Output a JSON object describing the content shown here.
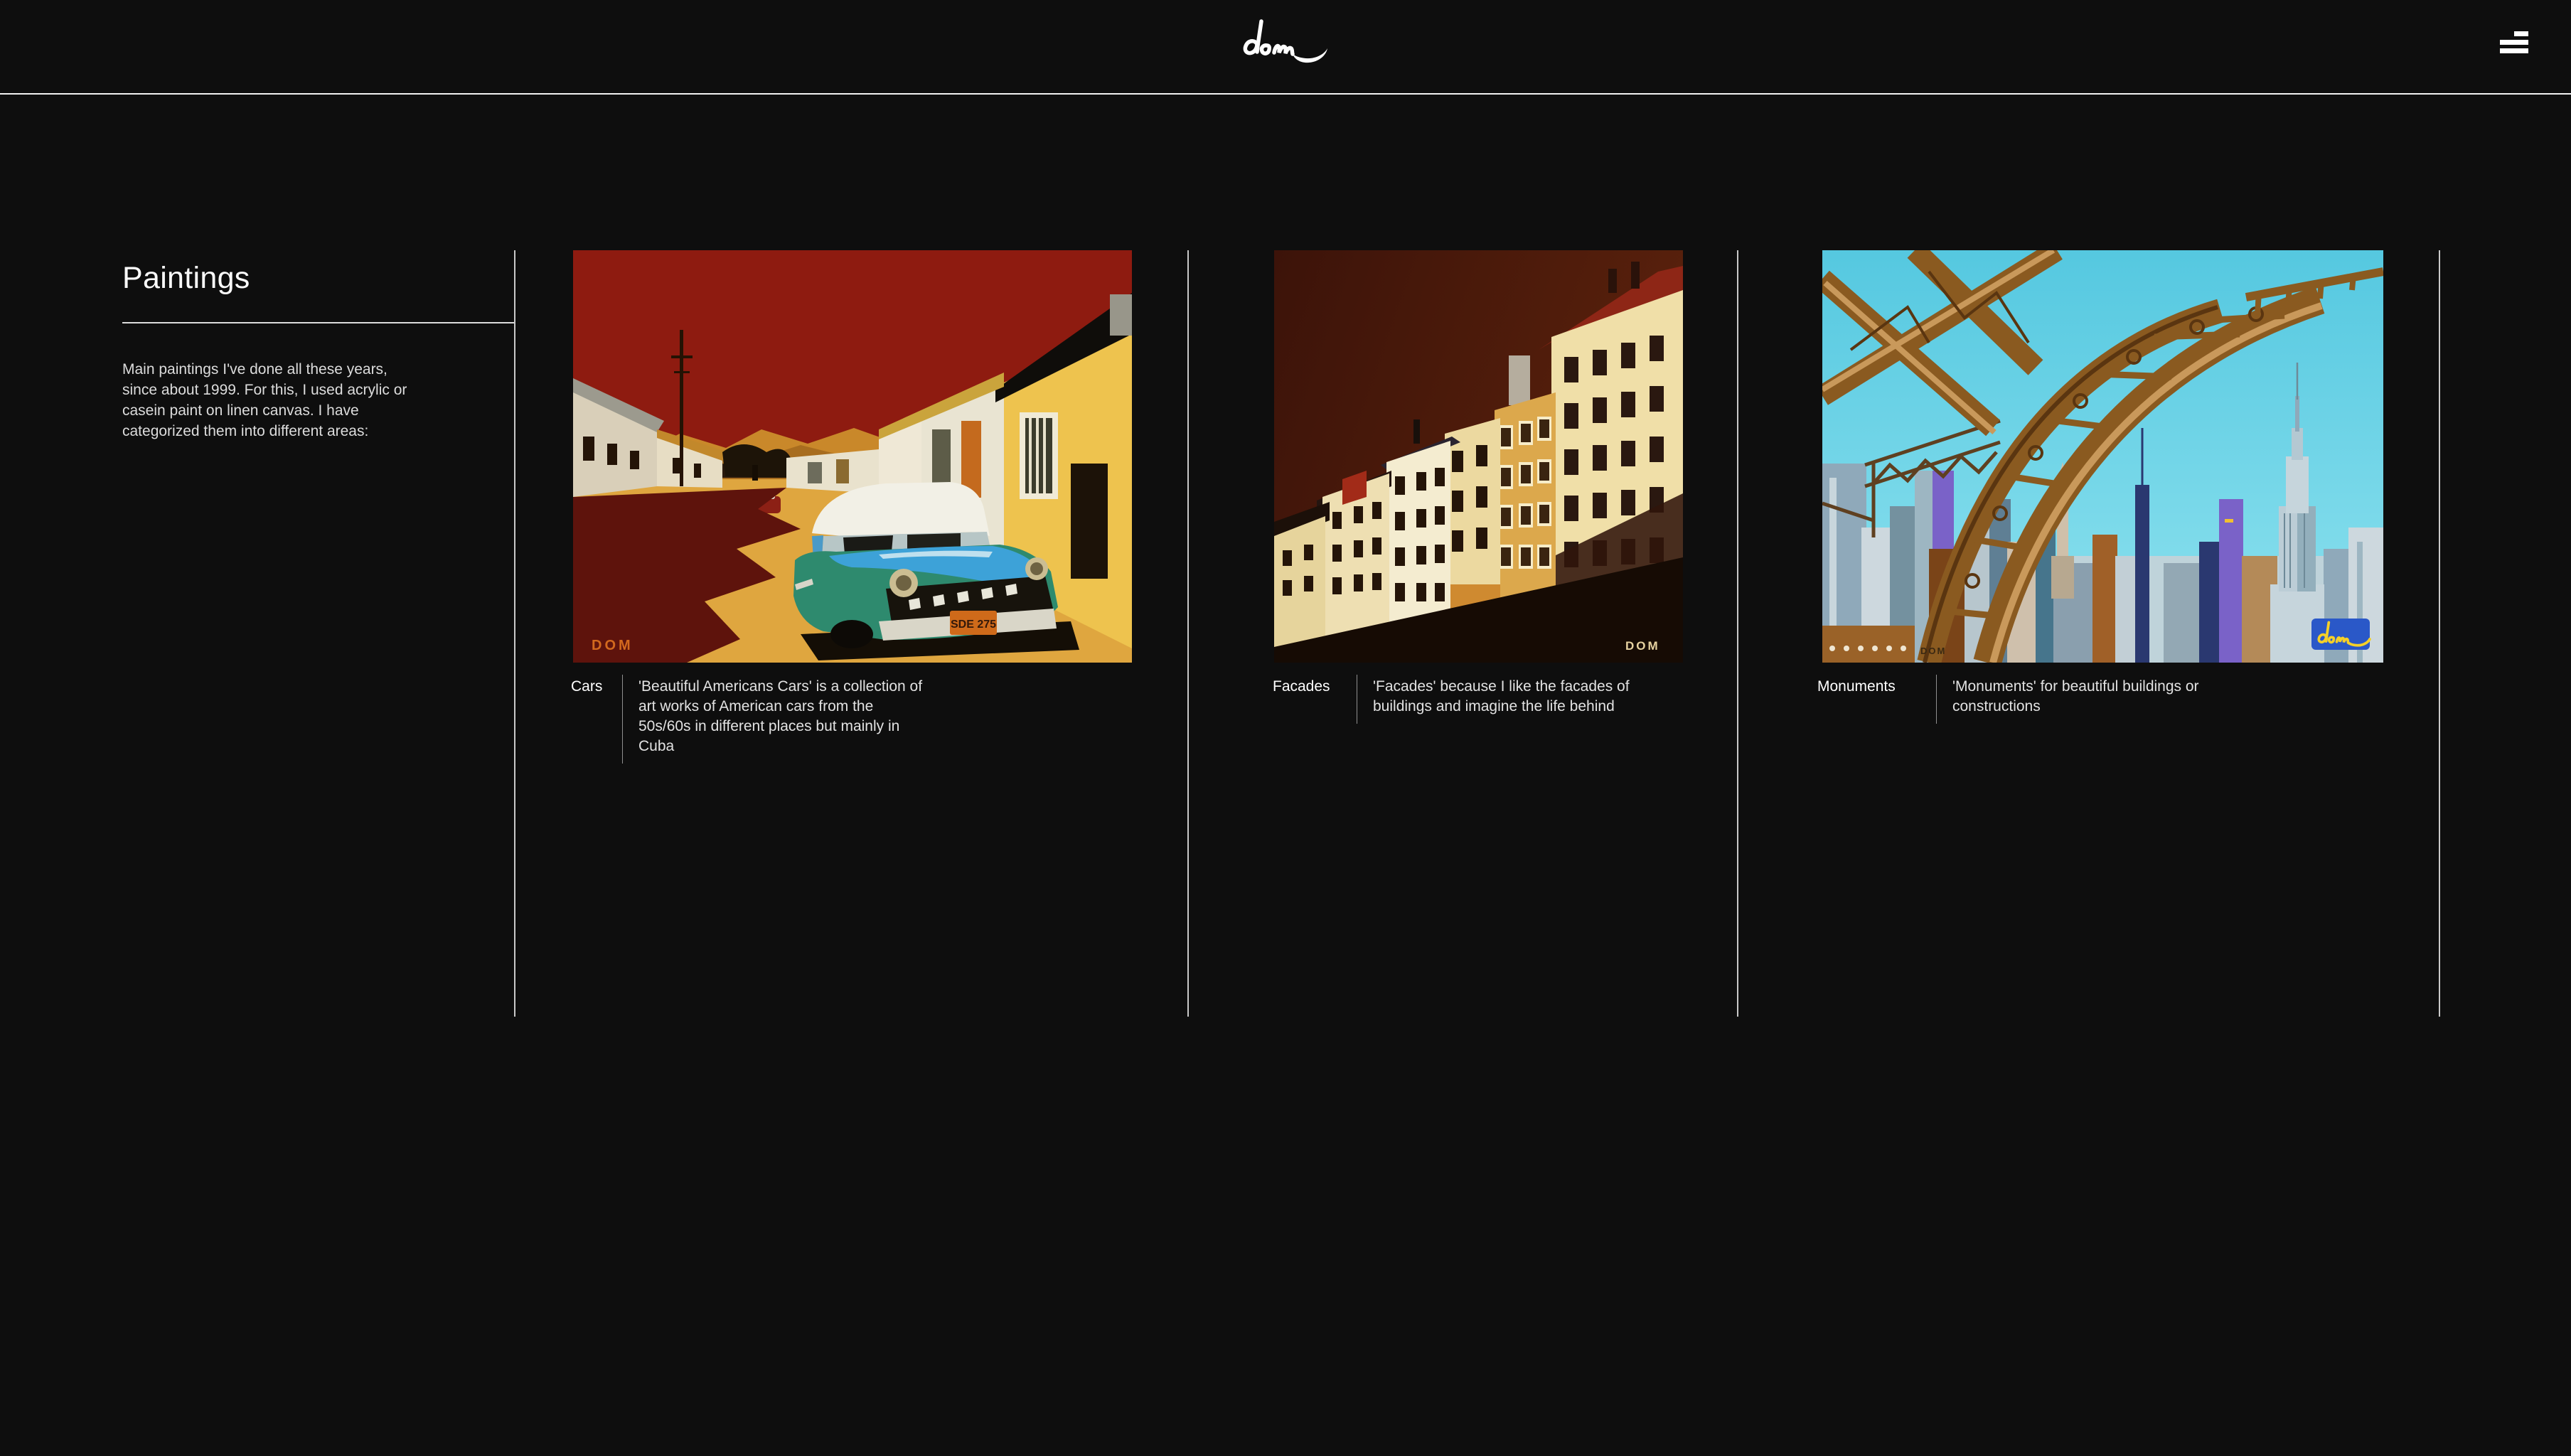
{
  "header": {
    "logo_text": "dom"
  },
  "sidebar": {
    "title": "Paintings",
    "description_lines": [
      "Main paintings I've done all these years,",
      "since about 1999. For this, I used acrylic or",
      "casein paint on linen canvas. I have",
      "categorized them into different areas:"
    ]
  },
  "cards": [
    {
      "label": "Cars",
      "description_lines": [
        "'Beautiful Americans Cars' is a collection of",
        "art works of American cars from the",
        "50s/60s in different places but mainly in",
        "Cuba"
      ],
      "painting": "cuban-street-with-classic-american-car",
      "signature": "DOM",
      "license_plate": "SDE 275"
    },
    {
      "label": "Facades",
      "description_lines": [
        "'Facades' because I like the facades of",
        "buildings and imagine the life behind"
      ],
      "painting": "paris-building-facades-at-dusk",
      "signature": "DOM"
    },
    {
      "label": "Monuments",
      "description_lines": [
        "'Monuments' for beautiful buildings or",
        "constructions"
      ],
      "painting": "eiffel-tower-arch-over-city-skyline",
      "signature": "DOM"
    }
  ],
  "colors": {
    "background": "#0e0e0e",
    "header_border": "#f2f2f2",
    "column_divider": "#c9c9c9",
    "text_primary": "#ffffff",
    "text_secondary": "#dcdcdc",
    "caption_rule": "#909090",
    "painting_cars_sky": "#8e1b10",
    "painting_facades_sky": "#4a180c",
    "painting_monuments_sky": "#62d2e6"
  }
}
